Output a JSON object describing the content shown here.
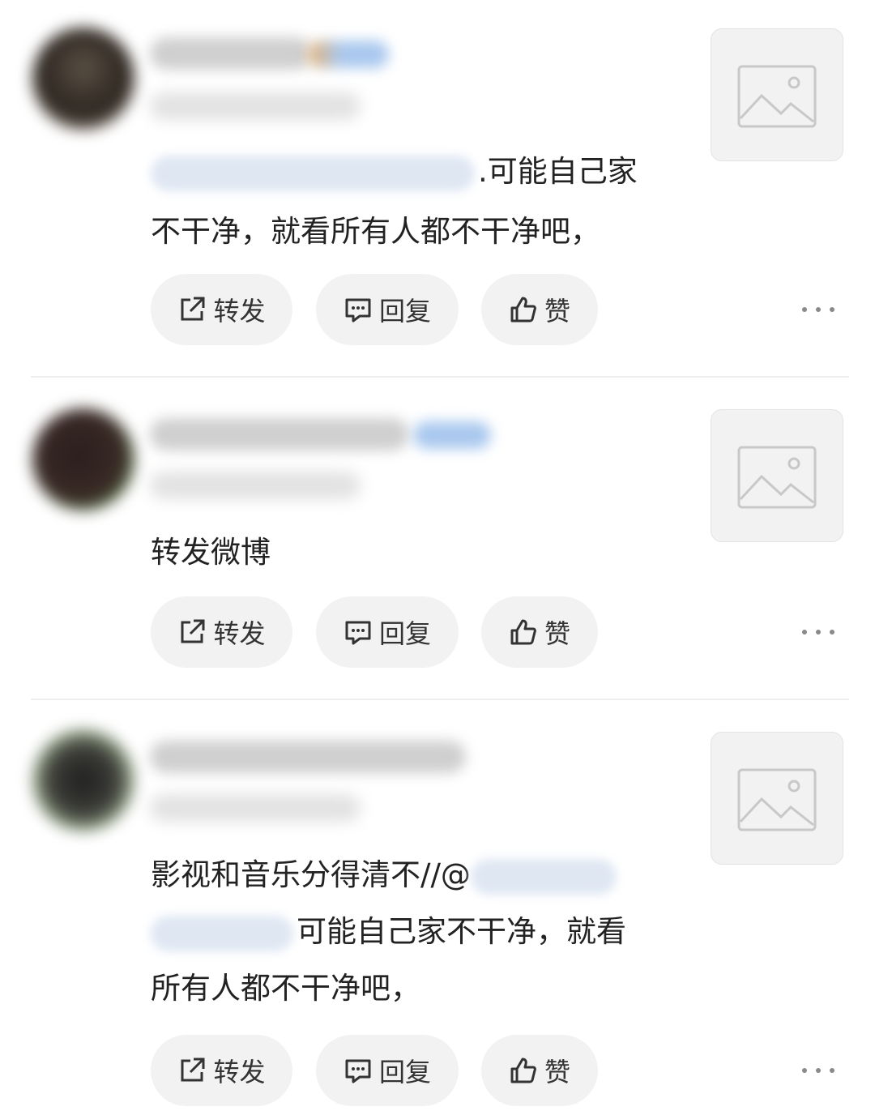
{
  "actions": {
    "repost_label": "转发",
    "reply_label": "回复",
    "like_label": "赞"
  },
  "posts": [
    {
      "text_line1_suffix": ".可能自己家",
      "text_line2": "不干净，就看所有人都不干净吧，"
    },
    {
      "text_line1": "转发微博"
    },
    {
      "text_line1_prefix": "影视和音乐分得清不//@",
      "text_line2_suffix": "可能自己家不干净，就看",
      "text_line3": "所有人都不干净吧，"
    }
  ],
  "icons": {
    "repost": "repost-icon",
    "reply": "comment-icon",
    "like": "thumbs-up-icon",
    "more": "more-dots-icon",
    "thumbnail": "image-placeholder-icon"
  },
  "colors": {
    "pill_bg": "#f2f2f2",
    "text": "#222222",
    "mention_blur": "#a9c8ee"
  }
}
